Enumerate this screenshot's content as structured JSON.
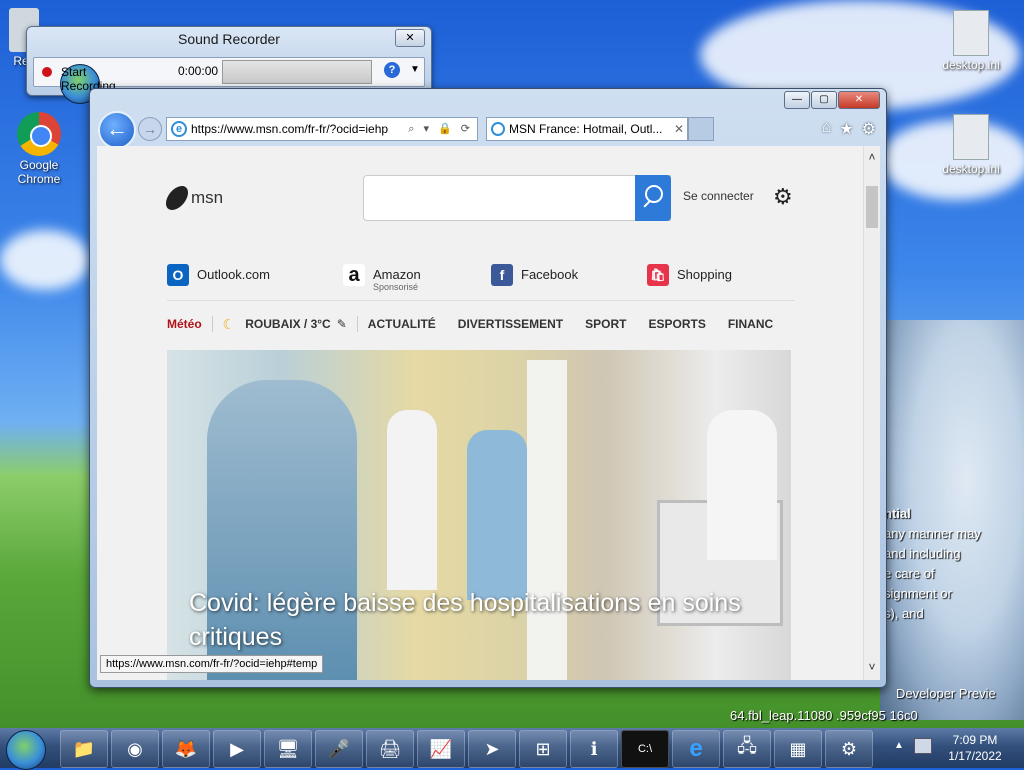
{
  "desktop": {
    "icons": [
      {
        "label": "Rec"
      },
      {
        "label": "Google\nChrome"
      },
      {
        "label": "desktop.ini"
      },
      {
        "label": "desktop.ini"
      }
    ],
    "watermark": {
      "line1": "ntial",
      "line2": "any manner may",
      "line3": "and including",
      "line4": "e care of",
      "line5": "signment or",
      "line6": "s), and",
      "line7": "Developer Previe",
      "line8": "64.fbl_leap.11080 .959cf95 16c0"
    }
  },
  "sound_recorder": {
    "title": "Sound Recorder",
    "close_glyph": "✕",
    "start_label": "Start Recording",
    "time": "0:00:00",
    "help_glyph": "?",
    "menu_glyph": "▼"
  },
  "browser": {
    "window_buttons": {
      "minimize": "—",
      "maximize": "▢",
      "close": "✕"
    },
    "back_glyph": "←",
    "forward_glyph": "→",
    "address": "https://www.msn.com/fr-fr/?ocid=iehp",
    "address_tools": "⌕ ▾ 🔒 ⟳",
    "tab_title": "MSN France: Hotmail, Outl...",
    "tab_close": "✕",
    "toolbar_icons": {
      "home": "⌂",
      "favorites": "★",
      "settings": "⚙"
    },
    "status_url": "https://www.msn.com/fr-fr/?ocid=iehp#temp",
    "scroll": {
      "up": "˄",
      "down": "˅"
    }
  },
  "msn": {
    "logo_text": "msn",
    "search_placeholder": "",
    "signin": "Se connecter",
    "shortcuts": [
      {
        "label": "Outlook.com",
        "sub": "",
        "icon": "outlook-icon",
        "color": "#0a64c2",
        "glyph": "O"
      },
      {
        "label": "Amazon",
        "sub": "Sponsorisé",
        "icon": "amazon-icon",
        "color": "#ffffff",
        "glyph": "a"
      },
      {
        "label": "Facebook",
        "sub": "",
        "icon": "facebook-icon",
        "color": "#3b5998",
        "glyph": "f"
      },
      {
        "label": "Shopping",
        "sub": "",
        "icon": "shopping-icon",
        "color": "#e8344a",
        "glyph": "🛍"
      }
    ],
    "nav": {
      "meteo": "Météo",
      "weather": "ROUBAIX / 3°C",
      "edit_glyph": "✎",
      "items": [
        "ACTUALITÉ",
        "DIVERTISSEMENT",
        "SPORT",
        "ESPORTS",
        "FINANC"
      ]
    },
    "hero_headline": "Covid: légère baisse des hospitalisations en soins critiques"
  },
  "taskbar": {
    "apps": [
      {
        "name": "explorer",
        "glyph": "📁"
      },
      {
        "name": "chrome",
        "glyph": "◉"
      },
      {
        "name": "firefox",
        "glyph": "🦊"
      },
      {
        "name": "media-player",
        "glyph": "▶"
      },
      {
        "name": "display",
        "glyph": "🖥"
      },
      {
        "name": "microphone",
        "glyph": "🎤"
      },
      {
        "name": "printer",
        "glyph": "🖨"
      },
      {
        "name": "chart-tool",
        "glyph": "📈"
      },
      {
        "name": "send",
        "glyph": "➤"
      },
      {
        "name": "windows-update",
        "glyph": "⊞"
      },
      {
        "name": "info",
        "glyph": "ℹ"
      },
      {
        "name": "cmd",
        "glyph": "C:\\"
      },
      {
        "name": "internet-explorer",
        "glyph": "e"
      },
      {
        "name": "network",
        "glyph": "🖧"
      },
      {
        "name": "firewall",
        "glyph": "▦"
      },
      {
        "name": "settings",
        "glyph": "⚙"
      }
    ],
    "time": "7:09 PM",
    "date": "1/17/2022"
  }
}
